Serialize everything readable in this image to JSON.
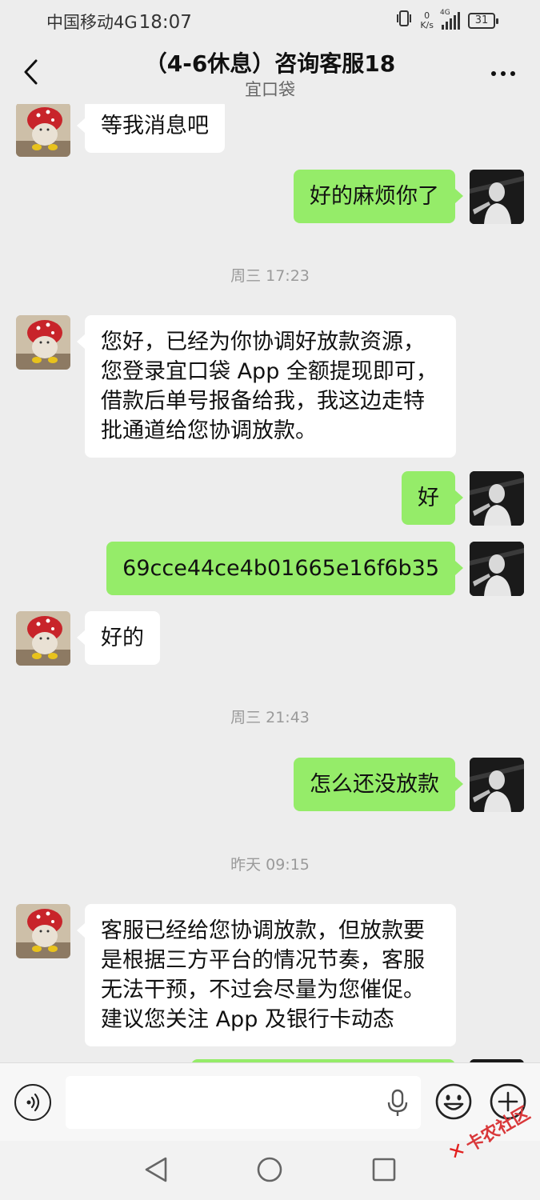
{
  "status_bar": {
    "carrier": "中国移动4G",
    "time": "18:07",
    "net_speed_value": "0",
    "net_speed_unit": "K/s",
    "signal_label": "4G",
    "battery": "31"
  },
  "header": {
    "title": "（4-6休息）咨询客服18",
    "subtitle": "宜口袋"
  },
  "messages": [
    {
      "side": "left",
      "text": "等我消息吧"
    },
    {
      "side": "right",
      "text": "好的麻烦你了"
    },
    {
      "type": "timestamp",
      "text": "周三 17:23"
    },
    {
      "side": "left",
      "lines": [
        "您好，已经为你协调好放款资源，",
        "您登录宜口袋 App 全额提现即可，",
        "借款后单号报备给我，我这边走特",
        "批通道给您协调放款。"
      ]
    },
    {
      "side": "right",
      "text": "好"
    },
    {
      "side": "right",
      "text": "69cce44ce4b01665e16f6b35"
    },
    {
      "side": "left",
      "text": "好的"
    },
    {
      "type": "timestamp",
      "text": "周三 21:43"
    },
    {
      "side": "right",
      "text": "怎么还没放款"
    },
    {
      "type": "timestamp",
      "text": "昨天 09:15"
    },
    {
      "side": "left",
      "lines": [
        "客服已经给您协调放款，但放款要",
        "是根据三方平台的情况节奏，客服",
        "无法干预，不过会尽量为您催促。",
        "建议您关注 App 及银行卡动态"
      ]
    }
  ],
  "input": {
    "value": "",
    "placeholder": ""
  },
  "watermark": {
    "text": "卡农社区"
  },
  "colors": {
    "background": "#ededed",
    "bubble_self": "#95ec69",
    "bubble_other": "#ffffff"
  },
  "icons": {
    "back": "chevron-left-icon",
    "more": "more-dots-icon",
    "voice": "voice-icon",
    "mic": "microphone-icon",
    "emoji": "emoji-icon",
    "plus": "plus-icon"
  }
}
